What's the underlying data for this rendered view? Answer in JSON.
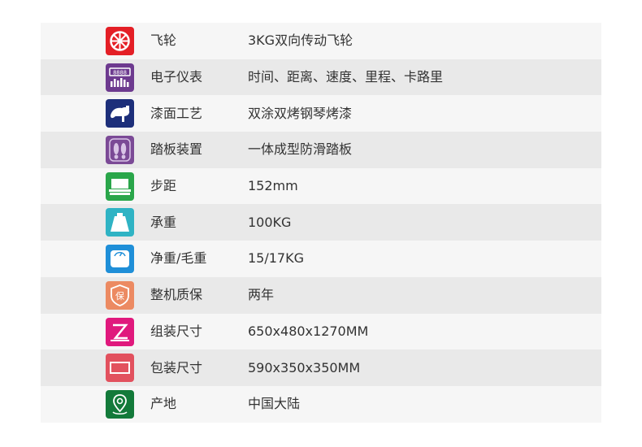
{
  "specs": [
    {
      "label": "飞轮",
      "value": "3KG双向传动飞轮",
      "icon": "flywheel-icon",
      "color": "#e41f26"
    },
    {
      "label": "电子仪表",
      "value": "时间、距离、速度、里程、卡路里",
      "icon": "display-meter-icon",
      "color": "#6d3a8f"
    },
    {
      "label": "漆面工艺",
      "value": "双涂双烤钢琴烤漆",
      "icon": "paint-process-icon",
      "color": "#1d2f7a"
    },
    {
      "label": "踏板装置",
      "value": "一体成型防滑踏板",
      "icon": "pedal-footprint-icon",
      "color": "#7b4a96"
    },
    {
      "label": "步距",
      "value": "152mm",
      "icon": "step-distance-icon",
      "color": "#2aa64a"
    },
    {
      "label": "承重",
      "value": "100KG",
      "icon": "weight-capacity-icon",
      "color": "#2fb3c4"
    },
    {
      "label": "净重/毛重",
      "value": " 15/17KG",
      "icon": "scale-icon",
      "color": "#1f8fd8"
    },
    {
      "label": "整机质保",
      "value": "两年",
      "icon": "warranty-shield-icon",
      "color": "#ec8a62"
    },
    {
      "label": "组装尺寸",
      "value": "650x480x1270MM",
      "icon": "assembled-size-icon",
      "color": "#e0197d"
    },
    {
      "label": "包装尺寸",
      "value": "590x350x350MM",
      "icon": "package-size-icon",
      "color": "#e2515e"
    },
    {
      "label": "产地",
      "value": "中国大陆",
      "icon": "location-pin-icon",
      "color": "#137a3a"
    }
  ]
}
